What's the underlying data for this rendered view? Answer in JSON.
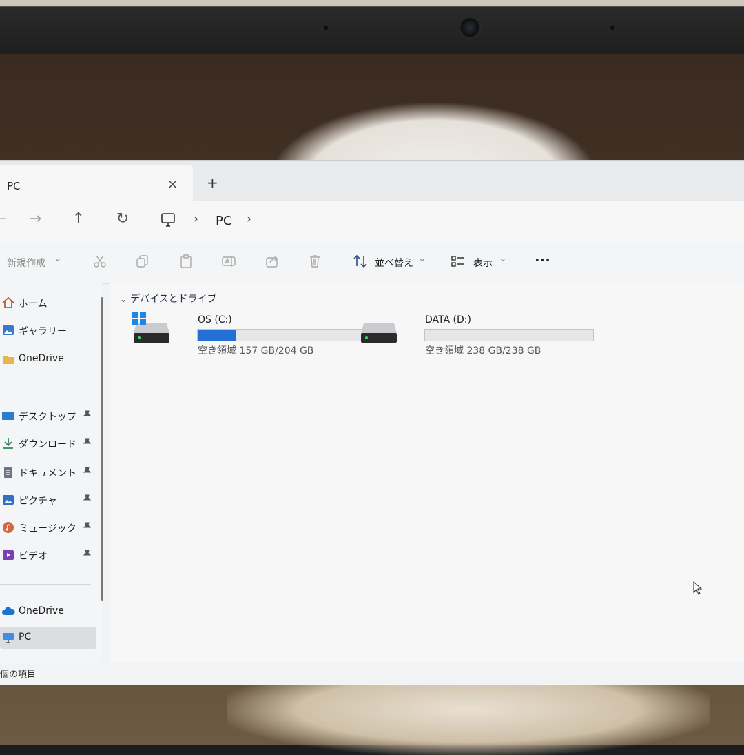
{
  "window": {
    "tab_title": "PC",
    "tab_close": "×",
    "new_tab": "+"
  },
  "address": {
    "back": "←",
    "forward": "→",
    "up": "↑",
    "refresh": "↻",
    "separator": "›",
    "location": "PC"
  },
  "toolbar": {
    "new_label": "新規作成",
    "new_caret": "⌄",
    "sort_label": "並べ替え",
    "sort_caret": "⌄",
    "view_label": "表示",
    "view_caret": "⌄",
    "more": "···"
  },
  "sidebar": {
    "items": [
      {
        "label": "ホーム",
        "icon": "home-icon"
      },
      {
        "label": "ギャラリー",
        "icon": "gallery-icon"
      },
      {
        "label": "OneDrive",
        "icon": "folder-icon"
      },
      {
        "label": "デスクトップ",
        "icon": "desktop-icon",
        "pinned": true
      },
      {
        "label": "ダウンロード",
        "icon": "download-icon",
        "pinned": true
      },
      {
        "label": "ドキュメント",
        "icon": "document-icon",
        "pinned": true
      },
      {
        "label": "ピクチャ",
        "icon": "pictures-icon",
        "pinned": true
      },
      {
        "label": "ミュージック",
        "icon": "music-icon",
        "pinned": true
      },
      {
        "label": "ビデオ",
        "icon": "video-icon",
        "pinned": true
      },
      {
        "label": "OneDrive",
        "icon": "cloud-icon"
      },
      {
        "label": "PC",
        "icon": "pc-icon",
        "selected": true
      }
    ],
    "pin_glyph": "📌"
  },
  "main": {
    "group_header": "デバイスとドライブ",
    "group_chevron": "⌄",
    "drives": [
      {
        "name": "OS (C:)",
        "free_text": "空き領域 157 GB/204 GB",
        "used_fraction": 0.23,
        "system": true
      },
      {
        "name": "DATA (D:)",
        "free_text": "空き領域 238 GB/238 GB",
        "used_fraction": 0.0,
        "system": false
      }
    ]
  },
  "status": {
    "text": "個の項目"
  },
  "colors": {
    "accent": "#2470d6"
  }
}
